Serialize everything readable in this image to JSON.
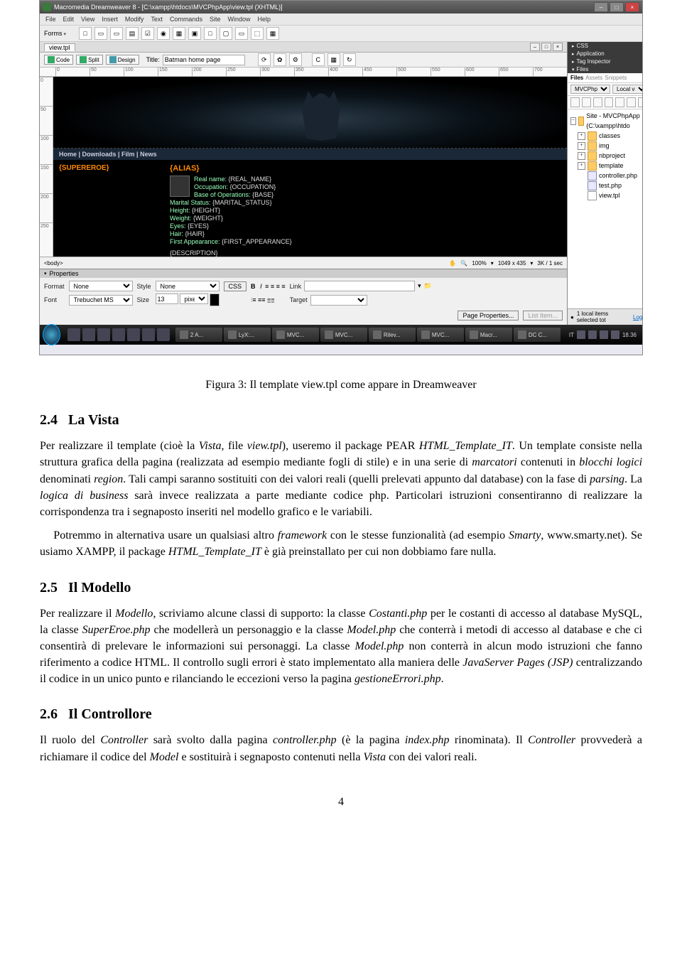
{
  "titlebar": {
    "text": "Macromedia Dreamweaver 8 - [C:\\xampp\\htdocs\\MVCPhpApp\\view.tpl (XHTML)]"
  },
  "menubar": [
    "File",
    "Edit",
    "View",
    "Insert",
    "Modify",
    "Text",
    "Commands",
    "Site",
    "Window",
    "Help"
  ],
  "toolbar": {
    "forms": "Forms"
  },
  "doc": {
    "tab": "view.tpl",
    "view": {
      "code": "Code",
      "split": "Split",
      "design": "Design"
    },
    "title_label": "Title:",
    "title_value": "Batman home page"
  },
  "ruler_marks": [
    "0",
    "50",
    "100",
    "150",
    "200",
    "250",
    "300",
    "350",
    "400",
    "450",
    "500",
    "550",
    "600",
    "650",
    "700"
  ],
  "vruler_marks": [
    "0",
    "50",
    "100",
    "150",
    "200",
    "250"
  ],
  "page": {
    "nav": "Home | Downloads | Film | News",
    "superhero": "{SUPEREROE}",
    "alias": "{ALIAS}",
    "real_name_lbl": "Real name",
    "real_name": "{REAL_NAME}",
    "occupation_lbl": "Occupation",
    "occupation": "{OCCUPATION}",
    "base_lbl": "Base of Operations",
    "base": "{BASE}",
    "marital_lbl": "Marital Status",
    "marital": "{MARITAL_STATUS}",
    "height_lbl": "Height",
    "height": "{HEIGHT}",
    "weight_lbl": "Weight",
    "weight": "{WEIGHT}",
    "eyes_lbl": "Eyes",
    "eyes": "{EYES}",
    "hair_lbl": "Hair",
    "hair": "{HAIR}",
    "first_lbl": "First Appearance",
    "first": "{FIRST_APPEARANCE}",
    "desc": "{DESCRIPTION}"
  },
  "status": {
    "tag": "<body>",
    "zoom": "100%",
    "size": "1049 x 435",
    "kb": "3K / 1 sec"
  },
  "props": {
    "title": "Properties",
    "format_lbl": "Format",
    "format_val": "None",
    "style_lbl": "Style",
    "style_val": "None",
    "css_lbl": "CSS",
    "link_lbl": "Link",
    "font_lbl": "Font",
    "font_val": "Trebuchet MS",
    "size_lbl": "Size",
    "size_val": "13",
    "size_unit": "pixels",
    "target_lbl": "Target",
    "page_props": "Page Properties...",
    "list_item": "List Item..."
  },
  "panels": {
    "css": "CSS",
    "app": "Application",
    "tag": "Tag Inspector",
    "files": "Files",
    "files_tab": "Files",
    "assets": "Assets",
    "snippets": "Snippets",
    "site_sel": "MVCPhpApp",
    "view_sel": "Local view",
    "site_root": "Site - MVCPhpApp (C:\\xampp\\htdo",
    "folders": [
      "classes",
      "img",
      "nbproject",
      "template"
    ],
    "files_list": [
      "controller.php",
      "test.php",
      "view.tpl"
    ],
    "status": "1 local items selected tot",
    "log": "Log..."
  },
  "taskbar": {
    "tasks": [
      "2 A...",
      "LyX:...",
      "MVC...",
      "MVC...",
      "Rilev...",
      "MVC...",
      "Macr...",
      "DC C..."
    ],
    "lang": "IT",
    "time": "18.36"
  },
  "document": {
    "caption": "Figura 3: Il template view.tpl come appare in Dreamweaver",
    "s24_num": "2.4",
    "s24_title": "La Vista",
    "p24_1a": "Per realizzare il template (cioè la ",
    "p24_1b": "Vista",
    "p24_1c": ", file ",
    "p24_1d": "view.tpl",
    "p24_1e": "), useremo il package PEAR ",
    "p24_1f": "HTML_Template_IT",
    "p24_1g": ". Un template consiste nella struttura grafica della pagina (realizzata ad esempio mediante fogli di stile) e in una serie di ",
    "p24_1h": "marcatori",
    "p24_1i": " contenuti in ",
    "p24_1j": "blocchi logici",
    "p24_1k": " denominati ",
    "p24_1l": "region",
    "p24_1m": ". Tali campi saranno sostituiti con dei valori reali (quelli prelevati appunto dal database) con la fase di ",
    "p24_1n": "parsing",
    "p24_1o": ". La ",
    "p24_1p": "logica di business",
    "p24_1q": " sarà invece realizzata a parte mediante codice php. Particolari istruzioni consentiranno di realizzare la corrispondenza tra i segnaposto inseriti nel modello grafico e le variabili.",
    "p24_2a": "Potremmo in alternativa usare un qualsiasi altro ",
    "p24_2b": "framework",
    "p24_2c": " con le stesse funzionalità (ad esempio ",
    "p24_2d": "Smarty",
    "p24_2e": ", www.smarty.net). Se usiamo XAMPP, il package ",
    "p24_2f": "HTML_Template_IT",
    "p24_2g": " è già preinstallato per cui non dobbiamo fare nulla.",
    "s25_num": "2.5",
    "s25_title": "Il Modello",
    "p25_1a": "Per realizzare il ",
    "p25_1b": "Modello",
    "p25_1c": ", scriviamo alcune classi di supporto: la classe ",
    "p25_1d": "Costanti.php",
    "p25_1e": " per le costanti di accesso al database MySQL, la classe ",
    "p25_1f": "SuperEroe.php",
    "p25_1g": " che modellerà un personaggio e la classe ",
    "p25_1h": "Model.php",
    "p25_1i": " che conterrà i metodi di accesso al database e che ci consentirà di prelevare le informazioni sui personaggi. La classe ",
    "p25_1j": "Model.php",
    "p25_1k": " non conterrà in alcun modo istruzioni che fanno riferimento a codice HTML. Il controllo sugli errori è stato implementato alla maniera delle ",
    "p25_1l": "JavaServer Pages (JSP)",
    "p25_1m": " centralizzando il codice in un unico punto e rilanciando le eccezioni verso la pagina ",
    "p25_1n": "gestioneErrori.php",
    "p25_1o": ".",
    "s26_num": "2.6",
    "s26_title": "Il Controllore",
    "p26_1a": "Il ruolo del ",
    "p26_1b": "Controller",
    "p26_1c": " sarà svolto dalla pagina ",
    "p26_1d": "controller.php",
    "p26_1e": " (è la pagina ",
    "p26_1f": "index.php",
    "p26_1g": " rinominata). Il ",
    "p26_1h": "Controller",
    "p26_1i": " provvederà a richiamare il codice del ",
    "p26_1j": "Model",
    "p26_1k": " e sostituirà i segnaposto contenuti nella ",
    "p26_1l": "Vista",
    "p26_1m": " con dei valori reali.",
    "pagenum": "4"
  }
}
